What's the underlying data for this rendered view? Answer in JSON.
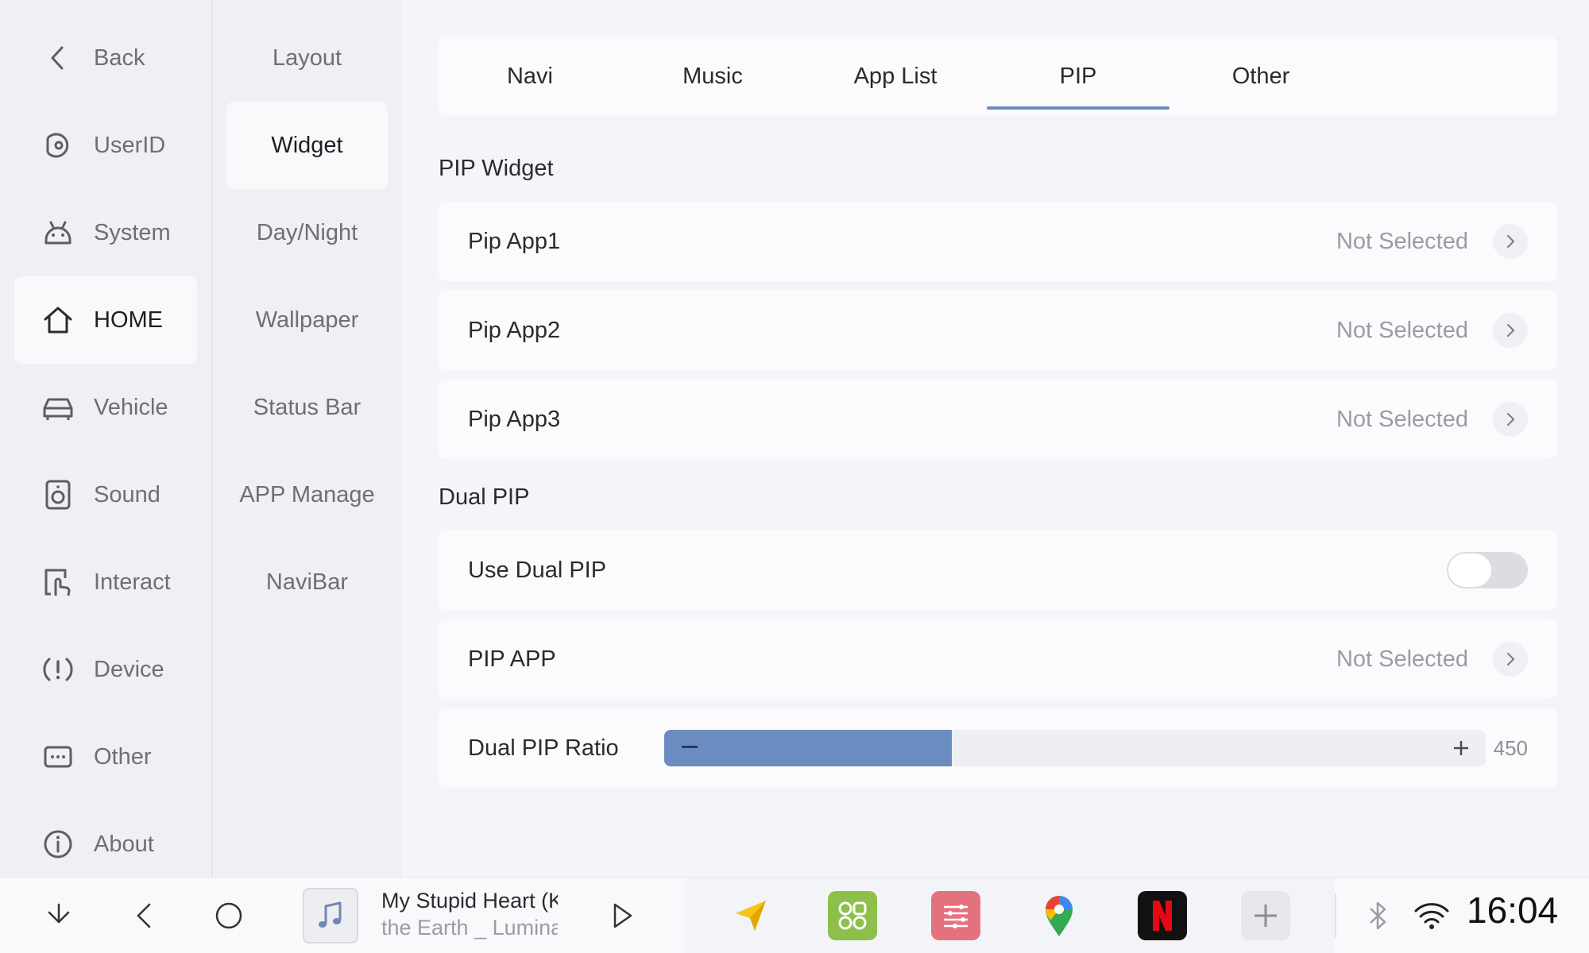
{
  "sidebar": {
    "items": [
      {
        "label": "Back",
        "icon": "back-icon"
      },
      {
        "label": "UserID",
        "icon": "userid-icon"
      },
      {
        "label": "System",
        "icon": "android-icon"
      },
      {
        "label": "HOME",
        "icon": "home-icon",
        "active": true
      },
      {
        "label": "Vehicle",
        "icon": "car-icon"
      },
      {
        "label": "Sound",
        "icon": "speaker-icon"
      },
      {
        "label": "Interact",
        "icon": "touch-icon"
      },
      {
        "label": "Device",
        "icon": "alert-icon"
      },
      {
        "label": "Other",
        "icon": "more-icon"
      },
      {
        "label": "About",
        "icon": "info-icon"
      }
    ]
  },
  "submenu": {
    "items": [
      {
        "label": "Layout"
      },
      {
        "label": "Widget",
        "active": true
      },
      {
        "label": "Day/Night"
      },
      {
        "label": "Wallpaper"
      },
      {
        "label": "Status Bar"
      },
      {
        "label": "APP Manage"
      },
      {
        "label": "NaviBar"
      }
    ]
  },
  "tabs": [
    {
      "label": "Navi"
    },
    {
      "label": "Music"
    },
    {
      "label": "App List"
    },
    {
      "label": "PIP",
      "active": true
    },
    {
      "label": "Other"
    }
  ],
  "pip_widget": {
    "title": "PIP Widget",
    "rows": [
      {
        "label": "Pip App1",
        "value": "Not Selected"
      },
      {
        "label": "Pip App2",
        "value": "Not Selected"
      },
      {
        "label": "Pip App3",
        "value": "Not Selected"
      }
    ]
  },
  "dual_pip": {
    "title": "Dual PIP",
    "use_label": "Use Dual PIP",
    "use_enabled": false,
    "app_label": "PIP APP",
    "app_value": "Not Selected",
    "ratio_label": "Dual PIP Ratio",
    "ratio_value": "450",
    "ratio_fraction": 0.35
  },
  "bottombar": {
    "media_title": "My Stupid Heart (Kids Version)",
    "media_artist": "the Earth _ Luminary",
    "clock": "16:04"
  },
  "colors": {
    "accent": "#6a8cc0",
    "background": "#eef0f4",
    "card": "#fbfbfd"
  }
}
